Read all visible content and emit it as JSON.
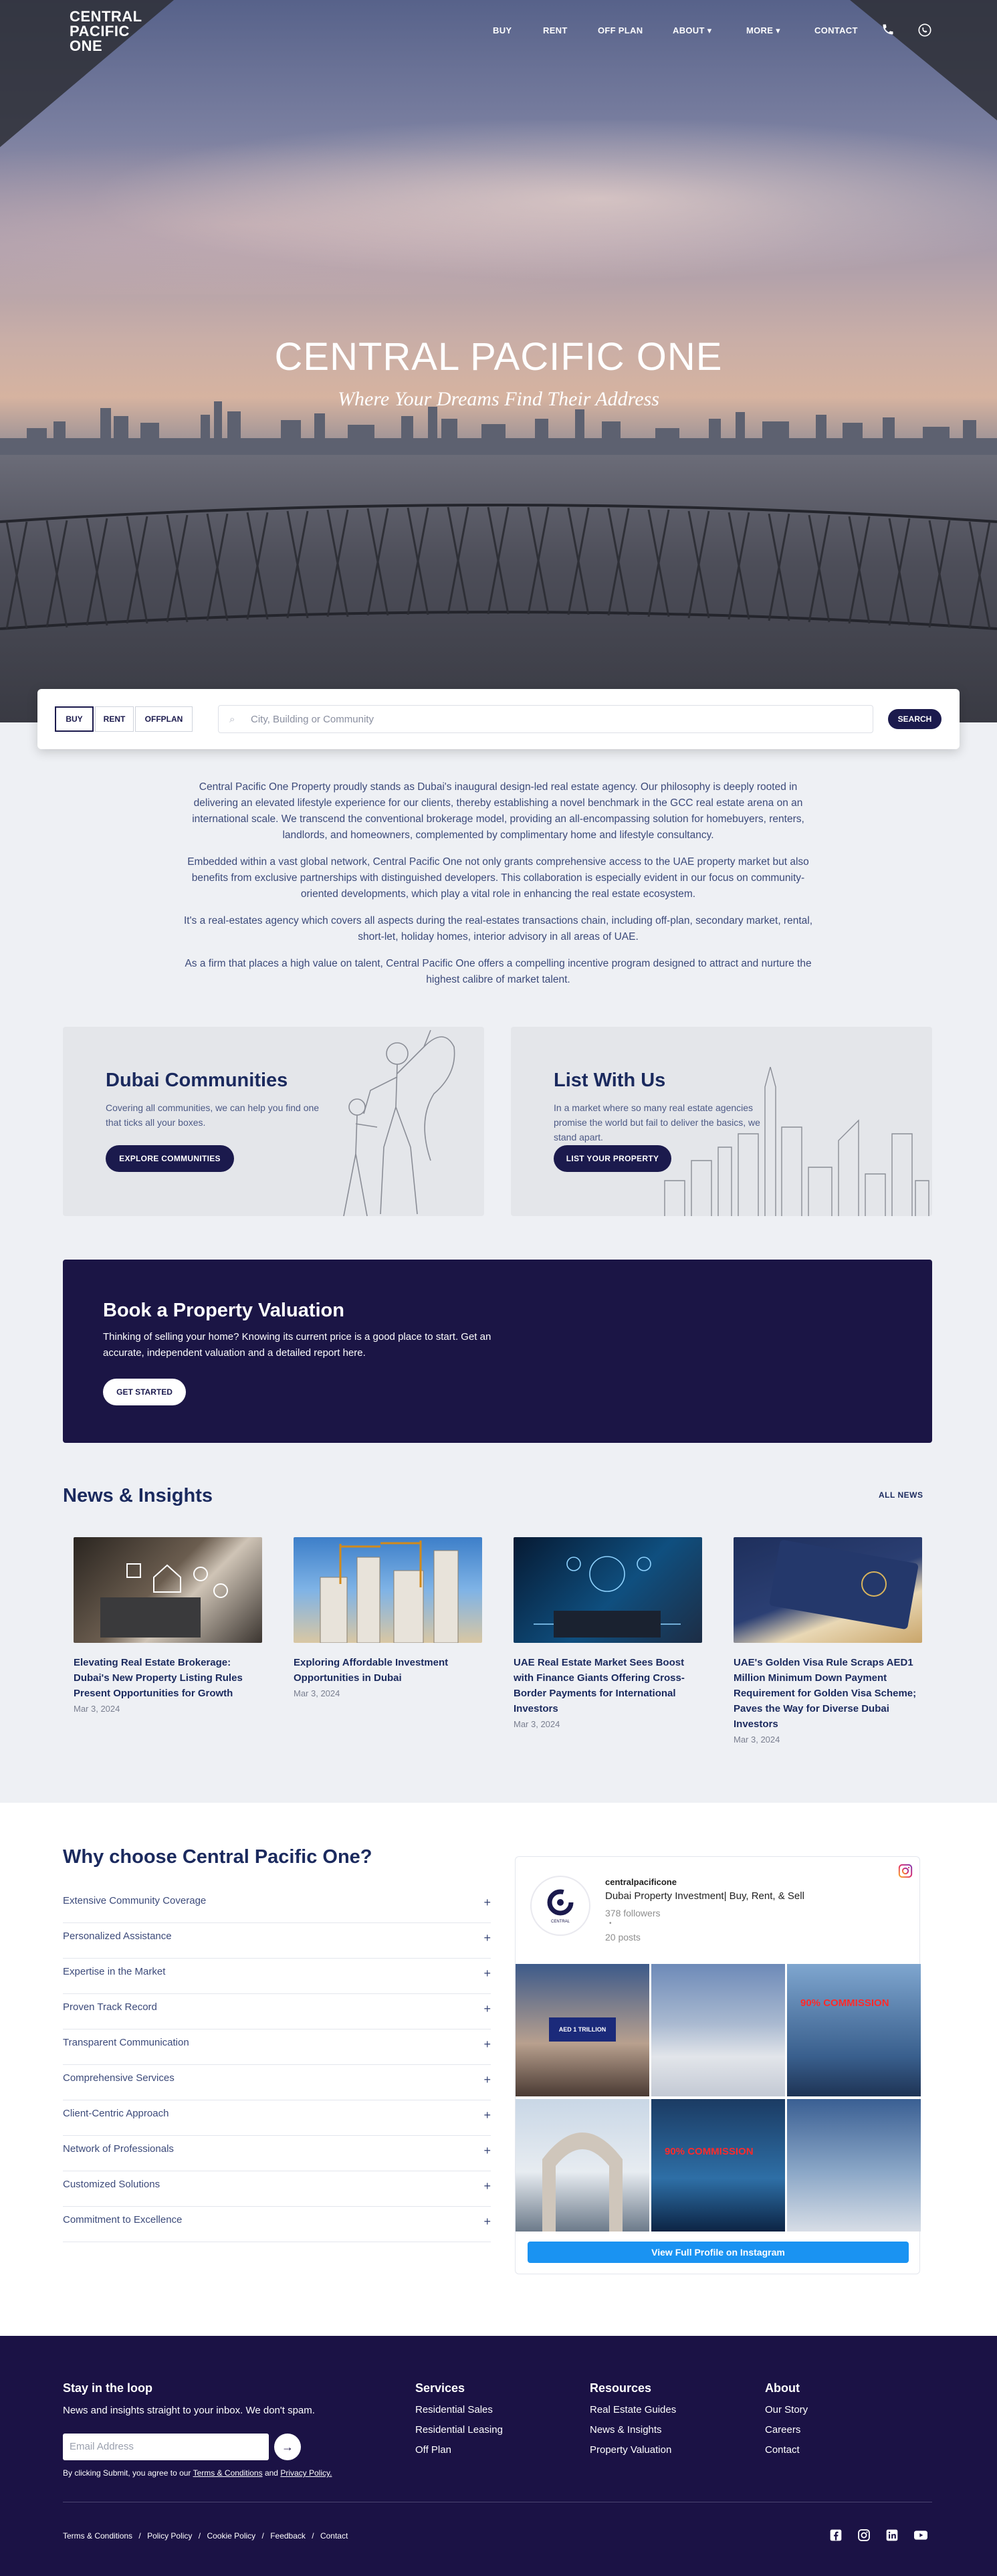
{
  "brand": {
    "logo_line1": "CENTRAL",
    "logo_line2": "PACIFIC",
    "logo_line3": "ONE"
  },
  "nav": {
    "buy": "BUY",
    "rent": "RENT",
    "offplan": "OFF PLAN",
    "about": "ABOUT",
    "more": "MORE",
    "contact": "CONTACT"
  },
  "hero": {
    "title": "CENTRAL PACIFIC ONE",
    "tagline": "Where Your Dreams Find Their Address"
  },
  "search": {
    "tab_buy": "BUY",
    "tab_rent": "RENT",
    "tab_offplan": "OFFPLAN",
    "placeholder": "City, Building or Community",
    "button": "SEARCH"
  },
  "intro": {
    "p1": "Central Pacific One Property proudly stands as Dubai's inaugural design-led real estate agency. Our philosophy is deeply rooted in delivering an elevated lifestyle experience for our clients, thereby establishing a novel benchmark in the GCC real estate arena on an international scale. We transcend the conventional brokerage model, providing an all-encompassing solution for homebuyers, renters, landlords, and homeowners, complemented by complimentary home and lifestyle consultancy.",
    "p2": "Embedded within a vast global network, Central Pacific One not only grants comprehensive access to the UAE property market but also benefits from exclusive partnerships with distinguished developers. This collaboration is especially evident in our focus on community-oriented developments, which play a vital role in enhancing the real estate ecosystem.",
    "p3": "It's a real-estates agency which covers all aspects during the real-estates transactions chain, including off-plan, secondary market, rental, short-let, holiday homes, interior advisory in all areas of UAE.",
    "p4": "As a firm that places a high value on talent, Central Pacific One offers a compelling incentive program designed to attract and nurture the highest calibre of market talent."
  },
  "communities": {
    "title": "Dubai Communities",
    "text": "Covering all communities, we can help you find one that ticks all your boxes.",
    "button": "EXPLORE COMMUNITIES"
  },
  "listing": {
    "title": "List With Us",
    "text": "In a market where so many real estate agencies promise the world but fail to deliver the basics, we stand apart.",
    "button": "LIST YOUR PROPERTY"
  },
  "valuation": {
    "title": "Book a Property Valuation",
    "text": "Thinking of selling your home? Knowing its current price is a good place to start. Get an accurate, independent valuation and a detailed report here.",
    "button": "GET STARTED"
  },
  "news": {
    "title": "News & Insights",
    "all_link": "ALL NEWS",
    "items": [
      {
        "title": "Elevating Real Estate Brokerage: Dubai's New Property Listing Rules Present Opportunities for Growth",
        "date": "Mar 3, 2024"
      },
      {
        "title": "Exploring Affordable Investment Opportunities in Dubai",
        "date": "Mar 3, 2024"
      },
      {
        "title": "UAE Real Estate Market Sees Boost with Finance Giants Offering Cross-Border Payments for International Investors",
        "date": "Mar 3, 2024"
      },
      {
        "title": "UAE's Golden Visa Rule Scraps AED1 Million Minimum Down Payment Requirement for Golden Visa Scheme; Paves the Way for Diverse Dubai Investors",
        "date": "Mar 3, 2024"
      }
    ]
  },
  "why": {
    "title": "Why choose Central Pacific One?",
    "items": [
      "Extensive Community Coverage",
      "Personalized Assistance",
      "Expertise in the Market",
      "Proven Track Record",
      "Transparent Communication",
      "Comprehensive Services",
      "Client-Centric Approach",
      "Network of Professionals",
      "Customized Solutions",
      "Commitment to Excellence"
    ]
  },
  "instagram": {
    "handle": "centralpacificone",
    "bio": "Dubai Property Investment| Buy, Rent, & Sell",
    "followers": "378 followers",
    "posts": "20 posts",
    "tile_label_1": "AED 1 TRILLION",
    "tile_label_2": "90% COMMISSION",
    "tile_label_3": "90% COMMISSION",
    "button": "View Full Profile on Instagram"
  },
  "footer": {
    "newsletter_title": "Stay in the loop",
    "newsletter_text": "News and insights straight to your inbox. We don't spam.",
    "email_placeholder": "Email Address",
    "consent_prefix": "By clicking Submit, you agree to our",
    "consent_terms": "Terms & Conditions",
    "consent_and": "and",
    "consent_privacy": "Privacy Policy.",
    "services_title": "Services",
    "services": [
      "Residential Sales",
      "Residential Leasing",
      "Off Plan"
    ],
    "resources_title": "Resources",
    "resources": [
      "Real Estate Guides",
      "News & Insights",
      "Property Valuation"
    ],
    "about_title": "About",
    "about": [
      "Our Story",
      "Careers",
      "Contact"
    ],
    "legal": [
      "Terms & Conditions",
      "Policy Policy",
      "Cookie Policy",
      "Feedback",
      "Contact"
    ],
    "separator": "/"
  },
  "colors": {
    "navy": "#1b1a4d",
    "footer": "#1b1245",
    "accent_blue": "#1a93f2",
    "heading": "#1b2a5e"
  },
  "icons": [
    "phone-icon",
    "whatsapp-icon",
    "search-icon",
    "plus-icon",
    "instagram-icon",
    "arrow-right-icon",
    "facebook-icon",
    "linkedin-icon",
    "youtube-icon"
  ]
}
